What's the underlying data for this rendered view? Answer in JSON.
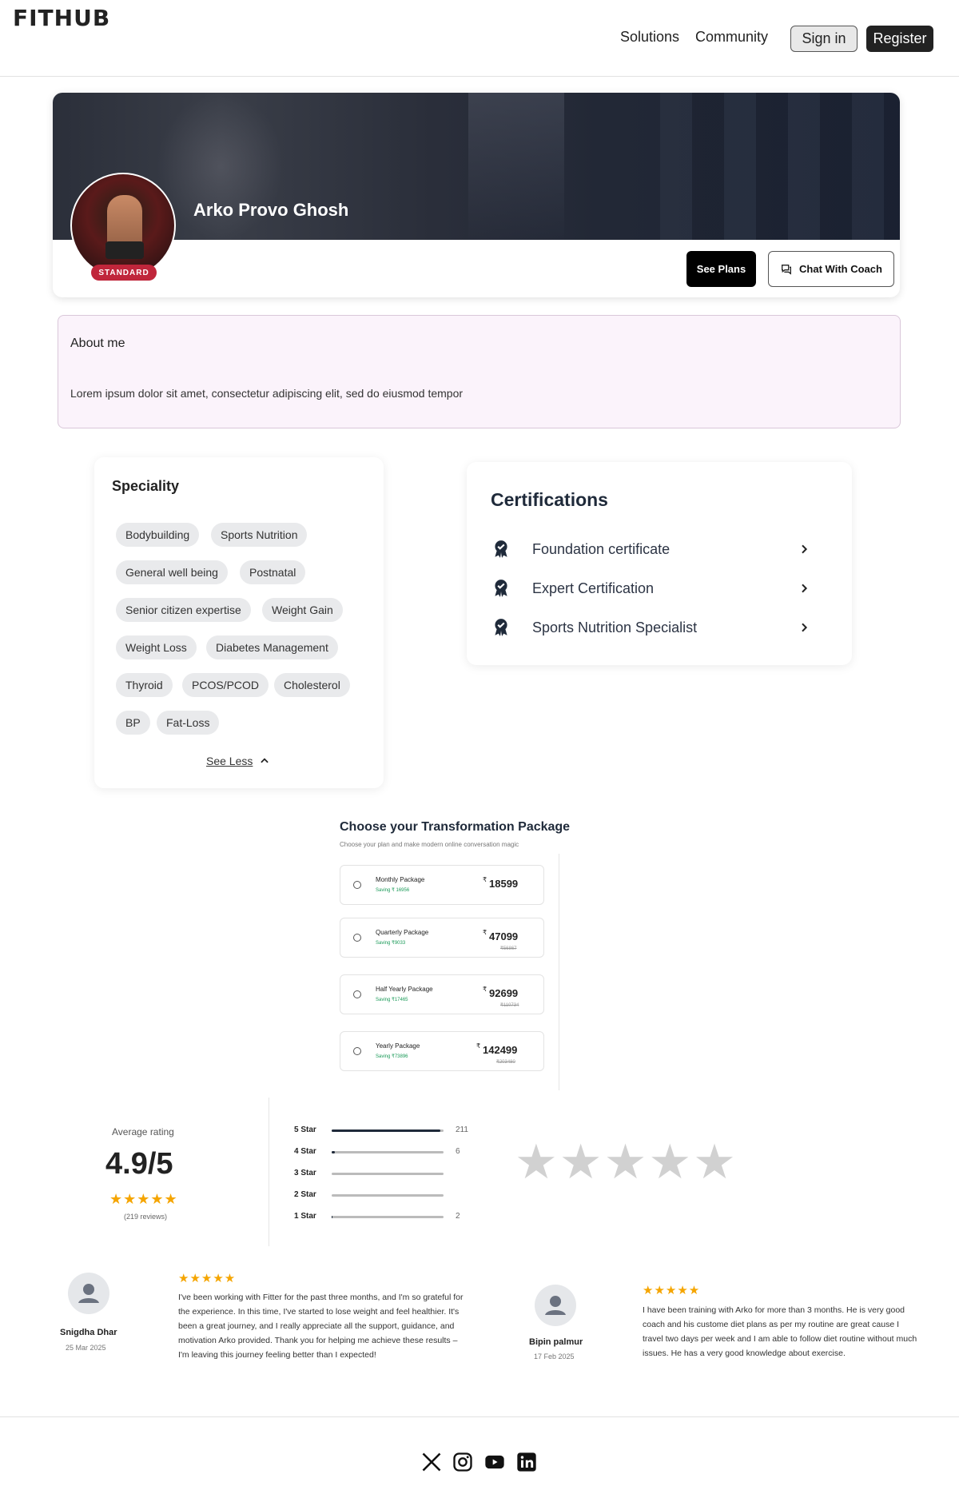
{
  "header": {
    "logo": "FITHUB",
    "nav": [
      "Solutions",
      "Community"
    ],
    "signin_label": "Sign in",
    "register_label": "Register"
  },
  "profile": {
    "name": "Arko Provo Ghosh",
    "badge": "STANDARD",
    "see_plans_label": "See Plans",
    "chat_label": "Chat With Coach"
  },
  "about": {
    "title": "About me",
    "text": "Lorem ipsum dolor sit amet, consectetur adipiscing elit, sed do eiusmod tempor"
  },
  "speciality": {
    "title": "Speciality",
    "tags": [
      "Bodybuilding",
      "Sports Nutrition",
      "General well being",
      "Postnatal",
      "Senior citizen expertise",
      "Weight Gain",
      "Weight Loss",
      "Diabetes Management",
      "Thyroid",
      "PCOS/PCOD",
      "Cholesterol",
      "BP",
      "Fat-Loss"
    ],
    "see_less_label": "See Less"
  },
  "certifications": {
    "title": "Certifications",
    "items": [
      "Foundation certificate",
      "Expert Certification",
      "Sports Nutrition Specialist"
    ]
  },
  "packages": {
    "title": "Choose your Transformation Package",
    "subtitle": "Choose your plan and make modern online conversation magic",
    "currency": "₹",
    "items": [
      {
        "name": "Monthly Package",
        "saving": "Saving ₹ 16956",
        "price": "18599",
        "old": ""
      },
      {
        "name": "Quarterly Package",
        "saving": "Saving ₹9033",
        "price": "47099",
        "old": "₹56867"
      },
      {
        "name": "Half Yearly Package",
        "saving": "Saving ₹17465",
        "price": "92699",
        "old": "₹110734"
      },
      {
        "name": "Yearly Package",
        "saving": "Saving ₹73896",
        "price": "142499",
        "old": "₹203480"
      }
    ]
  },
  "ratings": {
    "average_label": "Average rating",
    "average": "4.9/5",
    "review_count": "(219 reviews)",
    "average_stars": "★★★★★",
    "placeholder_stars": "★★★★★",
    "breakdown": [
      {
        "label": "5 Star",
        "count": "211",
        "fraction": 0.97
      },
      {
        "label": "4 Star",
        "count": "6",
        "fraction": 0.03
      },
      {
        "label": "3 Star",
        "count": "",
        "fraction": 0
      },
      {
        "label": "2 Star",
        "count": "",
        "fraction": 0
      },
      {
        "label": "1 Star",
        "count": "2",
        "fraction": 0.01
      }
    ]
  },
  "reviews": [
    {
      "name": "Snigdha Dhar",
      "date": "25 Mar 2025",
      "stars": "★★★★★",
      "text": "I've been working with Fitter for the past three months, and I'm so grateful for the experience. In this time, I've started to lose weight and feel healthier. It's been a great journey, and I really appreciate all the support, guidance, and motivation Arko provided. Thank you for helping me achieve these results – I'm leaving this journey feeling better than I expected!"
    },
    {
      "name": "Bipin palmur",
      "date": "17 Feb 2025",
      "stars": "★★★★★",
      "text": "I have been training with Arko for more than 3 months. He is very good coach and his custome diet plans as per my routine are great cause I travel two days per week and I am able to follow diet routine without much issues. He has a very good knowledge about exercise."
    }
  ],
  "footer": {
    "icons": [
      "x-icon",
      "instagram-icon",
      "youtube-icon",
      "linkedin-icon"
    ]
  },
  "colors": {
    "badge": "#c0263b",
    "star": "#f5a500",
    "saving": "#1a9a58",
    "about_bg": "#fbf3fb"
  }
}
